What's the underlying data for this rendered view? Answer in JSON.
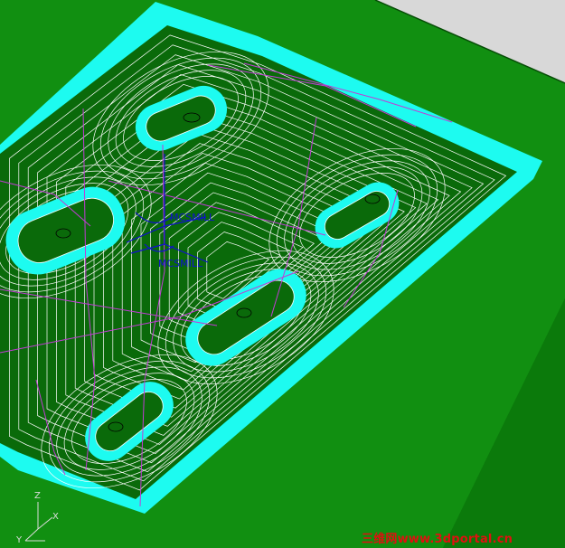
{
  "viewport": {
    "name": "cam-3d-toolpath-view"
  },
  "labels": {
    "wcs_primary": "MCSMILL",
    "wcs_secondary": "MCSMILL"
  },
  "triad": {
    "x": "X",
    "y": "Y",
    "z": "Z"
  },
  "watermark": "三维网www.3dportal.cn",
  "colors": {
    "background_green": "#0a6e0a",
    "part_top_green": "#118f11",
    "part_side_green": "#0b7a0b",
    "pocket_floor_green": "#0a6a0a",
    "pocket_wall_cyan": "#1dfbf0",
    "toolpath_white": "#ffffff",
    "engage_magenta": "#c23bd6",
    "wcs_blue": "#1010d0",
    "watermark_red": "#e01010",
    "grey_backdrop": "#d8d8d8"
  }
}
